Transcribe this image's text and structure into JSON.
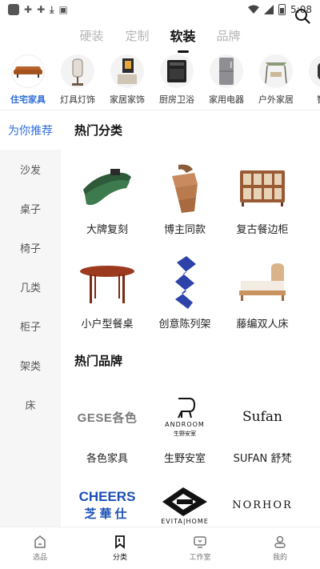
{
  "status_bar": {
    "time": "5:08"
  },
  "top_tabs": [
    "硬装",
    "定制",
    "软装",
    "品牌"
  ],
  "categories": [
    {
      "label": "住宅家具",
      "icon": "sofa-icon",
      "active": true
    },
    {
      "label": "灯具灯饰",
      "icon": "lamp-icon"
    },
    {
      "label": "家居家饰",
      "icon": "decor-icon"
    },
    {
      "label": "厨房卫浴",
      "icon": "stove-icon"
    },
    {
      "label": "家用电器",
      "icon": "fridge-icon"
    },
    {
      "label": "户外家居",
      "icon": "swing-icon"
    },
    {
      "label": "智能"
    }
  ],
  "sidebar": {
    "items": [
      "为你推荐",
      "沙发",
      "桌子",
      "椅子",
      "几类",
      "柜子",
      "架类",
      "床"
    ]
  },
  "sections": {
    "hot_categories": {
      "title": "热门分类",
      "items": [
        {
          "label": "大牌复刻",
          "icon": "green-sofa-icon"
        },
        {
          "label": "博主同款",
          "icon": "wood-chair-icon"
        },
        {
          "label": "复古餐边柜",
          "icon": "sideboard-icon"
        },
        {
          "label": "小户型餐桌",
          "icon": "dining-table-icon"
        },
        {
          "label": "创意陈列架",
          "icon": "zigzag-shelf-icon"
        },
        {
          "label": "藤编双人床",
          "icon": "rattan-bed-icon"
        }
      ]
    },
    "hot_brands": {
      "title": "热门品牌",
      "items": [
        {
          "label": "各色家具",
          "logo_text": "GESE各色"
        },
        {
          "label": "生野安室",
          "logo_text": "ANDROOM",
          "logo_sub": "生野安室"
        },
        {
          "label": "SUFAN 舒梵",
          "logo_text": "Sufan"
        },
        {
          "label": "",
          "logo_text": "CHEERS",
          "logo_sub": "芝華仕"
        },
        {
          "label": "",
          "logo_text": "EVITA|HOME"
        },
        {
          "label": "",
          "logo_text": "NORHOR"
        }
      ]
    }
  },
  "bottom_nav": [
    {
      "label": "选品",
      "icon": "home-icon"
    },
    {
      "label": "分类",
      "icon": "bookmark-icon",
      "active": true
    },
    {
      "label": "工作室",
      "icon": "studio-icon"
    },
    {
      "label": "我的",
      "icon": "profile-icon"
    }
  ],
  "colors": {
    "accent": "#2f6ed9"
  }
}
